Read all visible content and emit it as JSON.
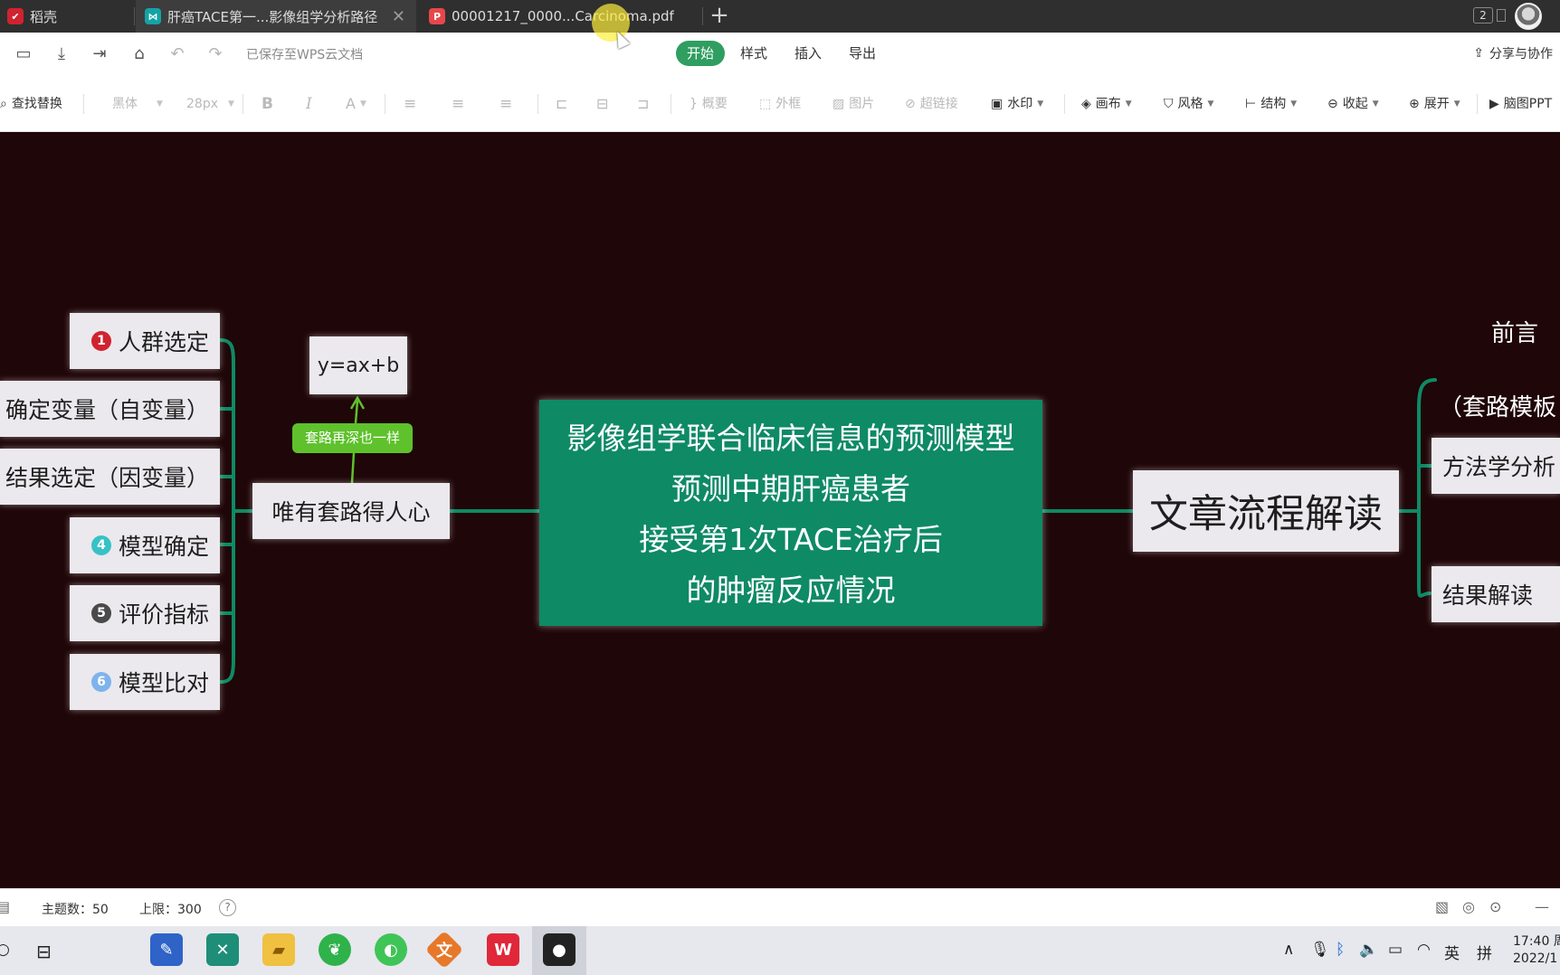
{
  "tabs": [
    {
      "label": "稻壳",
      "icon": "wps-docer-icon",
      "color": "#d0232f"
    },
    {
      "label": "肝癌TACE第一...影像组学分析路径",
      "icon": "mindmap-icon",
      "color": "#14a3a5",
      "active": true
    },
    {
      "label": "00001217_0000...Carcinoma.pdf",
      "icon": "pdf-icon",
      "color": "#e5474c"
    }
  ],
  "window": {
    "tab_count": "2"
  },
  "menubar": {
    "saved_status": "已保存至WPS云文档",
    "tabs": [
      "开始",
      "样式",
      "插入",
      "导出"
    ],
    "active_tab": "开始",
    "share": "分享与协作"
  },
  "toolbar": {
    "find_replace": "查找替换",
    "font": "黑体",
    "font_size": "28px",
    "bold": "B",
    "italic": "I",
    "font_color": "A",
    "summary": "概要",
    "frame": "外框",
    "image": "图片",
    "hyperlink": "超链接",
    "watermark": "水印",
    "canvas": "画布",
    "style": "风格",
    "structure": "结构",
    "collapse": "收起",
    "expand": "展开",
    "mindmap_ppt": "脑图PPT"
  },
  "mindmap": {
    "central": [
      "影像组学联合临床信息的预测模型",
      "预测中期肝癌患者",
      "接受第1次TACE治疗后",
      "的肿瘤反应情况"
    ],
    "left_main": "唯有套路得人心",
    "formula": "y=ax+b",
    "formula_tag": "套路再深也一样",
    "left_children": [
      {
        "num": "1",
        "label": "人群选定",
        "color": "#d0232f"
      },
      {
        "num": "",
        "label": "确定变量（自变量）",
        "color": ""
      },
      {
        "num": "",
        "label": "结果选定（因变量）",
        "color": ""
      },
      {
        "num": "4",
        "label": "模型确定",
        "color": "#37c2c6"
      },
      {
        "num": "5",
        "label": "评价指标",
        "color": "#4a4a4a"
      },
      {
        "num": "6",
        "label": "模型比对",
        "color": "#7fb3ec"
      }
    ],
    "right_main": "文章流程解读",
    "right_children": [
      "前言",
      "（套路模板",
      "方法学分析",
      "结果解读"
    ]
  },
  "statusbar": {
    "topics_label": "主题数：50",
    "limit_label": "上限：300"
  },
  "taskbar": {
    "ime_lang": "英",
    "ime_mode": "拼",
    "time": "17:40 周",
    "date": "2022/1"
  },
  "colors": {
    "canvas_bg": "#1f0608",
    "branch": "#0e8a65",
    "central_fill": "#0e8a65",
    "tag": "#5fc12c",
    "active_menu": "#2f9e60"
  }
}
